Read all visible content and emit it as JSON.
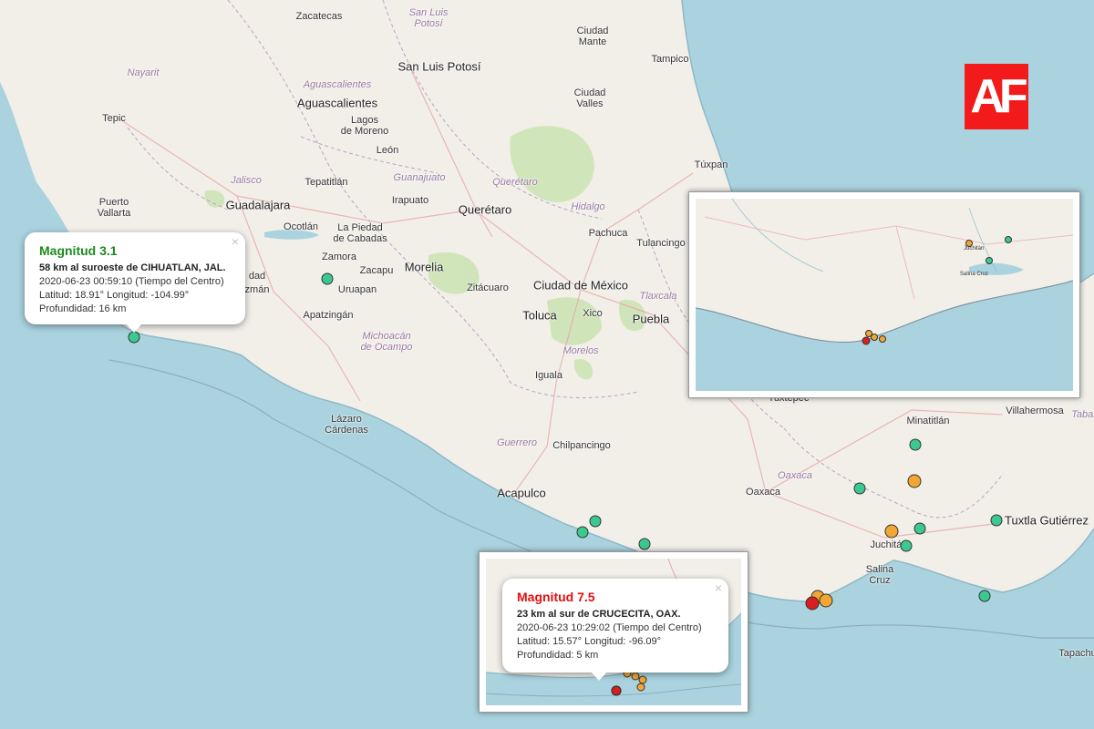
{
  "places": {
    "zacatecas": "Zacatecas",
    "san_luis_potosi_state": "San Luis\nPotosí",
    "ciudad_mante": "Ciudad\nMante",
    "tampico": "Tampico",
    "san_luis_potosi": "San Luis Potosí",
    "nayarit": "Nayarit",
    "aguascalientes_state": "Aguascalientes",
    "aguascalientes": "Aguascalientes",
    "ciudad_valles": "Ciudad\nValles",
    "tepic": "Tepic",
    "lagos_de_moreno": "Lagos\nde Moreno",
    "leon": "León",
    "guanajuato_state": "Guanajuato",
    "queretaro_state": "Querétaro",
    "jalisco": "Jalisco",
    "tepatitlan": "Tepatitlán",
    "irapuato": "Irapuato",
    "hidalgo": "Hidalgo",
    "tuxpan": "Túxpan",
    "puerto_vallarta": "Puerto\nVallarta",
    "guadalajara": "Guadalajara",
    "ocotlan": "Ocotlán",
    "la_piedad": "La Piedad\nde Cabadas",
    "queretaro": "Querétaro",
    "pachuca": "Pachuca",
    "tulancingo": "Tulancingo",
    "zamora": "Zamora",
    "zacapu": "Zacapu",
    "morelia": "Morelia",
    "tlaxcala": "Tlaxcala",
    "uruapan": "Uruapan",
    "ciudad_de_mexico": "Ciudad de México",
    "zitacuaro": "Zitácuaro",
    "toluca": "Toluca",
    "xico": "Xico",
    "puebla": "Puebla",
    "apatzingan": "Apatzingán",
    "michoacan": "Michoacán\nde Ocampo",
    "morelos": "Morelos",
    "iguala": "Iguala",
    "tuxtepec": "Tuxtepec",
    "minatitlan": "Minatitlán",
    "villahermosa": "Villahermosa",
    "tabasco": "Tabas",
    "lazaro_cardenas": "Lázaro\nCárdenas",
    "guerrero": "Guerrero",
    "chilpancingo": "Chilpancingo",
    "oaxaca_state": "Oaxaca",
    "oaxaca": "Oaxaca",
    "acapulco": "Acapulco",
    "tuxtla": "Tuxtla Gutiérrez",
    "juchitan": "Juchitán",
    "salina_cruz": "Salina\nCruz",
    "tapachula": "Tapachu",
    "manzanillo_partial": "zmán",
    "ciudad_guzman_partial": "dad"
  },
  "logo": {
    "text": "AF"
  },
  "popup_left": {
    "title": "Magnitud 3.1",
    "location": "58 km al suroeste de CIHUATLAN, JAL.",
    "datetime": "2020-06-23  00:59:10 (Tiempo del Centro)",
    "coords": "Latitud: 18.91°  Longitud: -104.99°",
    "depth": "Profundidad: 16 km",
    "close": "×",
    "title_color": "#1e8a1e"
  },
  "popup_bottom": {
    "title": "Magnitud 7.5",
    "location": "23 km al sur de CRUCECITA, OAX.",
    "datetime": "2020-06-23  10:29:02 (Tiempo del Centro)",
    "coords": "Latitud: 15.57°  Longitud: -96.09°",
    "depth": "Profundidad: 5 km",
    "close": "×",
    "title_color": "#e01010"
  },
  "inset_top": {
    "salina_cruz": "Salina Cruz",
    "juchitan": "Juchitán"
  },
  "colors": {
    "green": "#3cc98f",
    "orange": "#f2a634",
    "red": "#d81e1e",
    "land": "#f2efe9",
    "water": "#aad3df"
  }
}
